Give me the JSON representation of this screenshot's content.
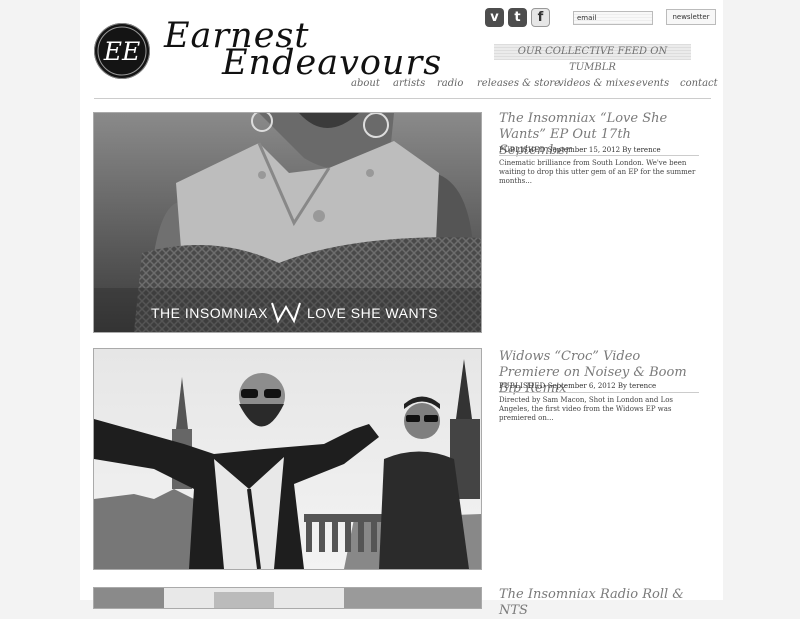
{
  "brand": {
    "line1": "Earnest",
    "line2": "Endeavours",
    "logo_text": "EE"
  },
  "social": {
    "vimeo": "v",
    "twitter": "t",
    "facebook": "f"
  },
  "newsletter": {
    "email_value": "email",
    "button_label": "newsletter"
  },
  "tumblr_link": "OUR COLLECTIVE FEED ON TUMBLR",
  "nav": [
    "about",
    "artists",
    "radio",
    "releases & store",
    "videos & mixes",
    "events",
    "contact"
  ],
  "posts": [
    {
      "title": "The Insomniax “Love She Wants” EP Out 17th September",
      "published_label": "PUBLISHED",
      "meta": "September 15, 2012 By terence",
      "excerpt": "Cinematic brilliance from South London. We've been waiting to drop this utter gem of an EP for the summer months...",
      "image_caption_left": "THE INSOMNIAX",
      "image_caption_right": "LOVE SHE WANTS"
    },
    {
      "title": "Widows “Croc” Video Premiere on Noisey & Boom Bip Remix",
      "published_label": "PUBLISHED",
      "meta": "September 6, 2012 By terence",
      "excerpt": "Directed by Sam Macon, Shot in London and Los Angeles, the first video from the Widows EP was premiered on..."
    },
    {
      "title": "The Insomniax Radio Roll & NTS"
    }
  ]
}
